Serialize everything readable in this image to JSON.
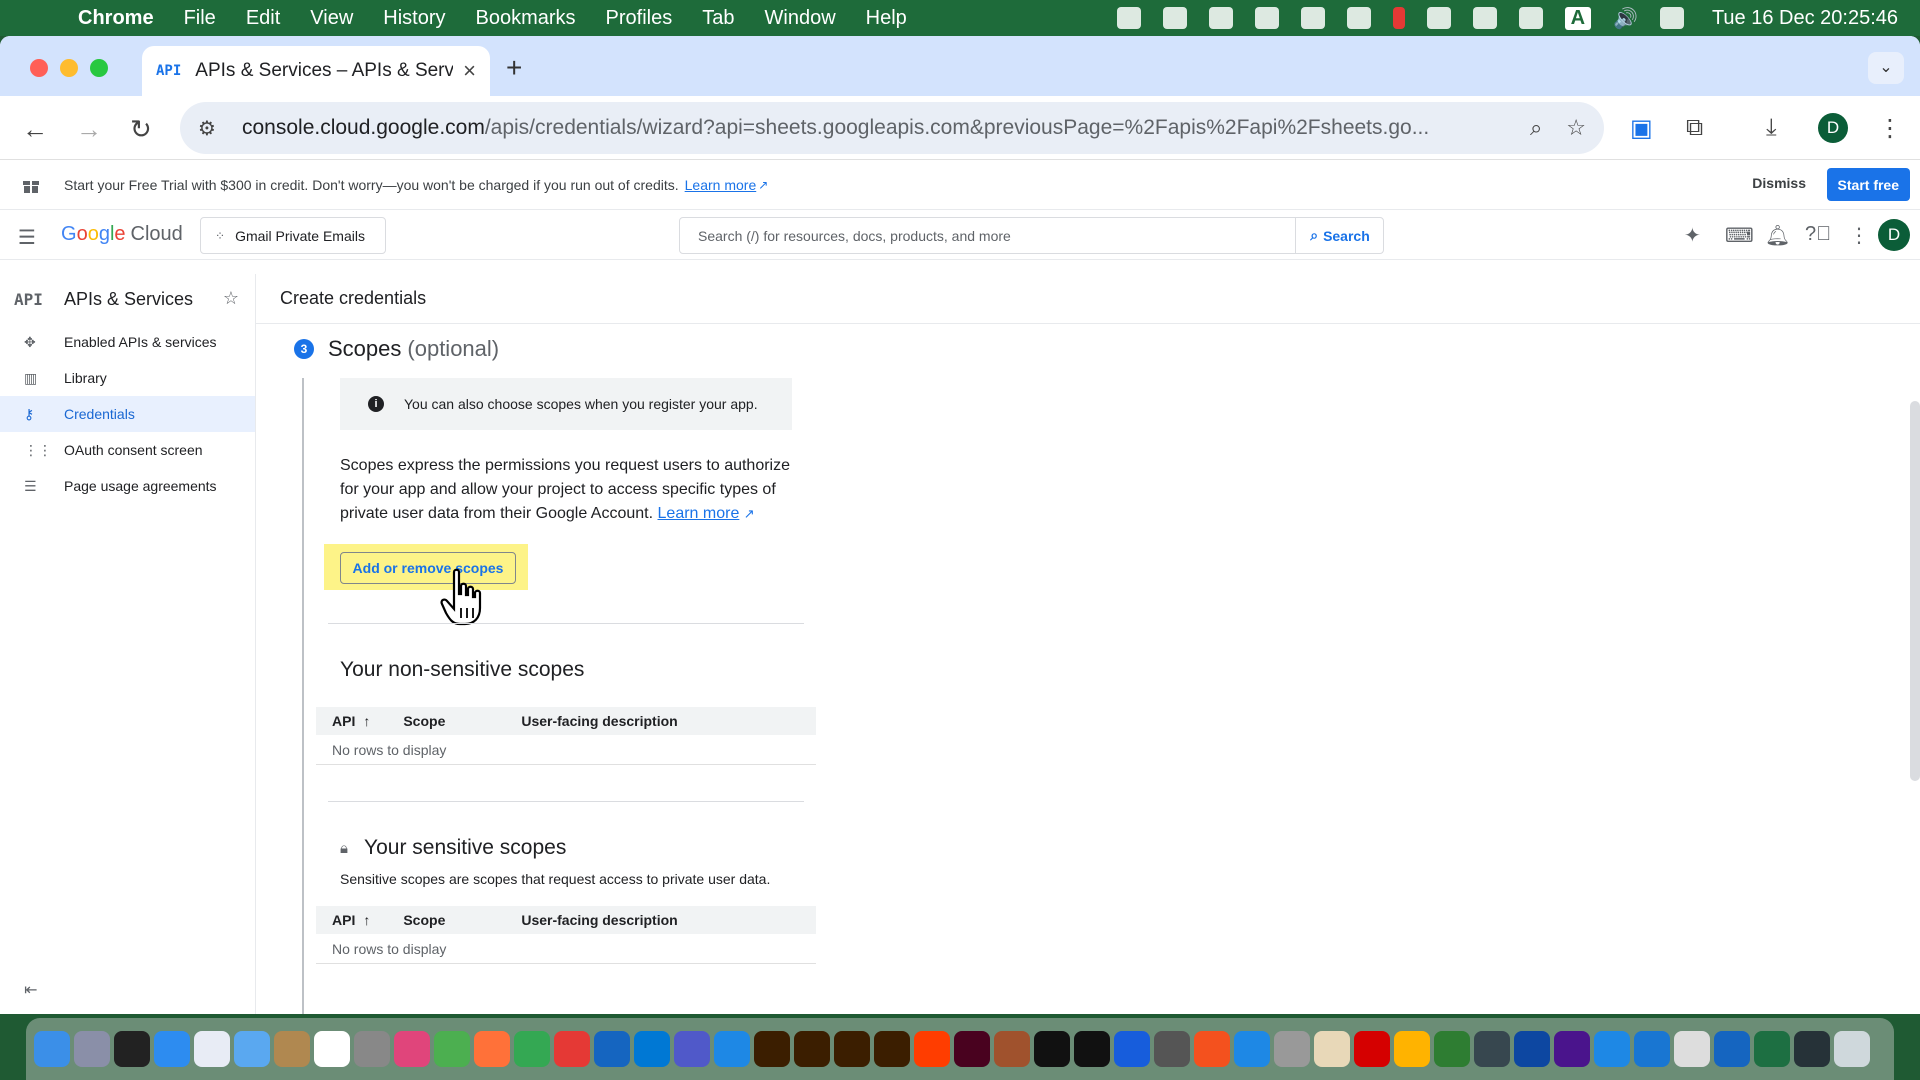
{
  "menubar": {
    "app": "Chrome",
    "items": [
      "File",
      "Edit",
      "View",
      "History",
      "Bookmarks",
      "Profiles",
      "Tab",
      "Window",
      "Help"
    ],
    "tray_input": "A",
    "clock": "Tue 16 Dec  20:25:46"
  },
  "browser": {
    "tab_title": "APIs & Services – APIs & Services",
    "tab_favicon": "API",
    "url_host": "console.cloud.google.com",
    "url_path": "/apis/credentials/wizard?api=sheets.googleapis.com&previousPage=%2Fapis%2Fapi%2Fsheets.go...",
    "profile_initial": "D"
  },
  "banner": {
    "text": "Start your Free Trial with $300 in credit. Don't worry—you won't be charged if you run out of credits.",
    "link": "Learn more",
    "dismiss": "Dismiss",
    "start": "Start free"
  },
  "header": {
    "logo_google": [
      "G",
      "o",
      "o",
      "g",
      "l",
      "e"
    ],
    "logo_cloud": "Cloud",
    "project": "Gmail Private Emails",
    "search_placeholder": "Search (/) for resources, docs, products, and more",
    "search_button": "Search",
    "avatar": "D"
  },
  "sidebar": {
    "title": "APIs & Services",
    "title_icon": "API",
    "items": [
      {
        "label": "Enabled APIs & services",
        "icon": "diamond-grid-icon"
      },
      {
        "label": "Library",
        "icon": "library-icon"
      },
      {
        "label": "Credentials",
        "icon": "key-icon"
      },
      {
        "label": "OAuth consent screen",
        "icon": "consent-icon"
      },
      {
        "label": "Page usage agreements",
        "icon": "settings-list-icon"
      }
    ],
    "active_index": 2
  },
  "main": {
    "page_title": "Create credentials",
    "step_number": "3",
    "step_title": "Scopes",
    "step_optional": "(optional)",
    "info_text": "You can also choose scopes when you register your app.",
    "description": "Scopes express the permissions you request users to authorize for your app and allow your project to access specific types of private user data from their Google Account.",
    "description_link": "Learn more",
    "add_button": "Add or remove scopes",
    "nonsensitive": {
      "title": "Your non-sensitive scopes",
      "columns": [
        "API",
        "Scope",
        "User-facing description"
      ],
      "empty": "No rows to display"
    },
    "sensitive": {
      "title": "Your sensitive scopes",
      "subtitle": "Sensitive scopes are scopes that request access to private user data.",
      "columns": [
        "API",
        "Scope",
        "User-facing description"
      ],
      "empty": "No rows to display"
    }
  },
  "colors": {
    "accent": "#1a73e8",
    "highlight": "#fdf388",
    "active_bg": "#e8f0fe"
  }
}
